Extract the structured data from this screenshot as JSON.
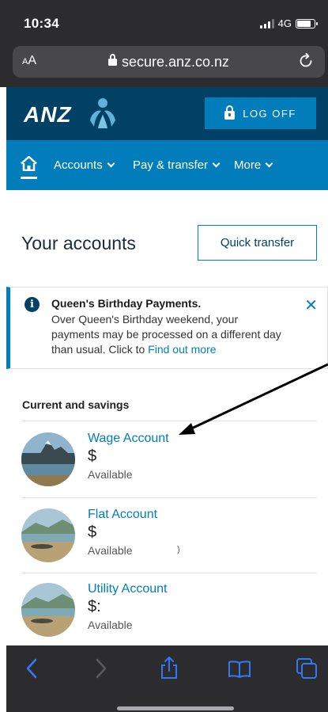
{
  "status_bar": {
    "time": "10:34",
    "network": "4G"
  },
  "browser": {
    "text_size_label": "AA",
    "url": "secure.anz.co.nz"
  },
  "header": {
    "logo_text": "ANZ",
    "logoff_label": "LOG OFF"
  },
  "nav": {
    "items": [
      {
        "label": "Accounts"
      },
      {
        "label": "Pay & transfer"
      },
      {
        "label": "More"
      }
    ]
  },
  "page": {
    "title": "Your accounts",
    "quick_transfer_label": "Quick transfer"
  },
  "notice": {
    "title": "Queen's Birthday Payments.",
    "body": "Over Queen's Birthday weekend, your payments may be processed on a different day than usual. Click to ",
    "link": "Find out more",
    "close_symbol": "✕"
  },
  "section": {
    "label": "Current and savings"
  },
  "accounts": [
    {
      "name": "Wage Account",
      "balance": "$",
      "available_label": "Available",
      "mark": ""
    },
    {
      "name": "Flat Account",
      "balance": "$",
      "available_label": "Available",
      "mark": ")"
    },
    {
      "name": "Utility Account",
      "balance": "$:",
      "available_label": "Availablе",
      "mark": ""
    }
  ],
  "colors": {
    "brand_dark": "#004165",
    "brand_blue": "#007dba",
    "browser_chrome": "#2c2c2e",
    "toolbar_icon": "#3478f6"
  },
  "icons": [
    "lock-icon",
    "reload-icon",
    "home-icon",
    "chevron-down-icon",
    "info-icon",
    "close-icon",
    "back-icon",
    "forward-icon",
    "share-icon",
    "bookmarks-icon",
    "tabs-icon"
  ]
}
